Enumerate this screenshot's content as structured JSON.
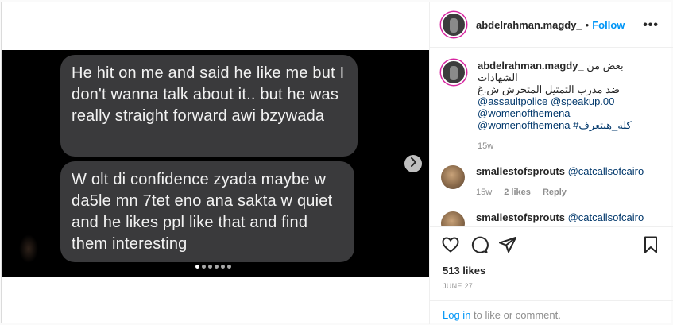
{
  "post": {
    "media": {
      "bubble1": "He hit on me and said he like me but I don't wanna talk about it.. but he was really straight forward awi bzywada",
      "bubble2": "W olt di confidence zyada maybe w da5le mn 7tet eno ana sakta w quiet and he likes ppl like that and find them interesting",
      "slide_count": 6,
      "active_slide": 1
    },
    "header": {
      "username": "abdelrahman.magdy_",
      "separator": "•",
      "follow_label": "Follow",
      "more_label": "•••"
    },
    "caption": {
      "username": "abdelrahman.magdy_",
      "line1": "بعض من الشهادات",
      "line2": "ضد مدرب التمثيل المتحرش ش.غ",
      "mentions1": "@assaultpolice @speakup.00",
      "mentions2": "@womenofthemena",
      "mentions3": "@womenofthemena #كله_هيتعرف",
      "time": "15w"
    },
    "comments": [
      {
        "username": "smallestofsprouts",
        "text": "@catcallsofcairo",
        "time": "15w",
        "likes": "2 likes",
        "reply": "Reply"
      },
      {
        "username": "smallestofsprouts",
        "text": "@catcallsofcairo"
      }
    ],
    "likes": "513 likes",
    "date": "JUNE 27",
    "login": {
      "link": "Log in",
      "rest": " to like or comment."
    },
    "colors": {
      "accent": "#0095f6",
      "mention": "#00376b",
      "bubble": "#3a3a3c",
      "secondary_text": "#8e8e8e"
    }
  }
}
